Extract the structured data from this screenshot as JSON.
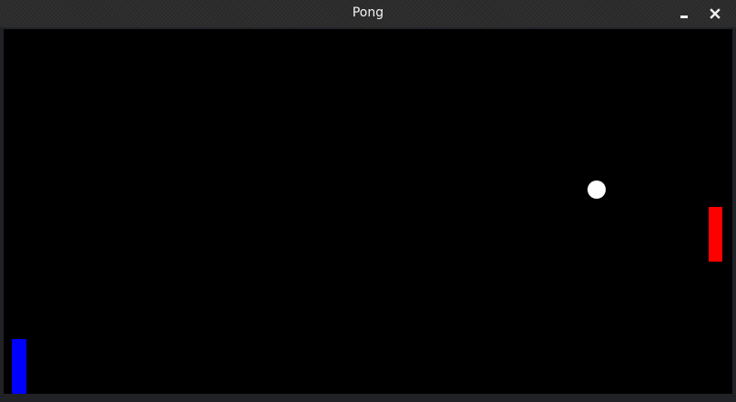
{
  "window": {
    "title": "Pong"
  },
  "controls": {
    "minimize_icon": "minimize-icon",
    "close_icon": "close-icon"
  },
  "colors": {
    "background": "#000000",
    "left_paddle": "#0000ff",
    "right_paddle": "#ff0000",
    "ball": "#ffffff"
  }
}
